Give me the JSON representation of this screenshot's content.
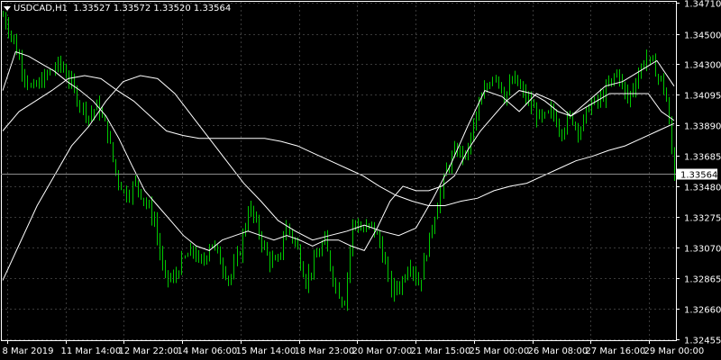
{
  "header": {
    "symbol": "USDCAD,H1",
    "ohlc": "1.33527 1.33572 1.33520 1.33564"
  },
  "colors": {
    "background": "#000000",
    "grid": "#3a3a3a",
    "axis": "#ffffff",
    "candles": "#00c800",
    "ma": "#ffffff",
    "price_line": "#8c8c8c",
    "price_label_bg": "#ffffff",
    "price_label_text": "#000000"
  },
  "chart_data": {
    "type": "line",
    "title": "USDCAD,H1",
    "ylim": [
      1.3245,
      1.3472
    ],
    "y_ticks": [
      1.3471,
      1.345,
      1.343,
      1.34095,
      1.3389,
      1.33685,
      1.3348,
      1.33275,
      1.3307,
      1.32865,
      1.3266,
      1.32455
    ],
    "y_tick_labels": [
      "1.34710",
      "1.34500",
      "1.34300",
      "1.34095",
      "1.33890",
      "1.33685",
      "1.33480",
      "1.33275",
      "1.33070",
      "1.32865",
      "1.32660",
      "1.32455"
    ],
    "x_tick_labels": [
      "8 Mar 2019",
      "11 Mar 14:00",
      "12 Mar 22:00",
      "14 Mar 06:00",
      "15 Mar 14:00",
      "18 Mar 23:00",
      "20 Mar 07:00",
      "21 Mar 15:00",
      "25 Mar 00:00",
      "26 Mar 08:00",
      "27 Mar 16:00",
      "29 Mar 00:00"
    ],
    "current_price": 1.33564,
    "current_price_label": "1.33564",
    "grid": true,
    "series": [
      {
        "values": [
          1.3462,
          1.3448,
          1.3428,
          1.3412,
          1.3418,
          1.3425,
          1.343,
          1.342,
          1.3405,
          1.3395,
          1.3402,
          1.3385,
          1.3355,
          1.3342,
          1.335,
          1.3338,
          1.3325,
          1.3288,
          1.3285,
          1.3298,
          1.3305,
          1.3295,
          1.3312,
          1.3298,
          1.3285,
          1.3305,
          1.3335,
          1.3318,
          1.33,
          1.3295,
          1.3322,
          1.3308,
          1.3285,
          1.3298,
          1.3312,
          1.3285,
          1.3268,
          1.3325,
          1.3318,
          1.3322,
          1.3308,
          1.3278,
          1.3282,
          1.3298,
          1.3282,
          1.331,
          1.3338,
          1.3362,
          1.3372,
          1.3368,
          1.3395,
          1.3412,
          1.3425,
          1.3408,
          1.342,
          1.341,
          1.34,
          1.3392,
          1.3398,
          1.3385,
          1.3395,
          1.3385,
          1.3402,
          1.3405,
          1.3415,
          1.3425,
          1.3405,
          1.342,
          1.3435,
          1.3425,
          1.3412,
          1.3356
        ]
      },
      {
        "values": [
          1.3412,
          1.3438,
          1.3435,
          1.343,
          1.3425,
          1.3418,
          1.3412,
          1.3405,
          1.3395,
          1.338,
          1.3362,
          1.3345,
          1.3335,
          1.3325,
          1.3315,
          1.3308,
          1.3305,
          1.3312,
          1.3315,
          1.3318,
          1.3315,
          1.3312,
          1.3315,
          1.3312,
          1.3308,
          1.3312,
          1.3312,
          1.3308,
          1.3305,
          1.332,
          1.3338,
          1.3348,
          1.3345,
          1.3345,
          1.3348,
          1.3355,
          1.3372,
          1.3385,
          1.3395,
          1.3405,
          1.3412,
          1.341,
          1.3405,
          1.3398,
          1.3395,
          1.34,
          1.3405,
          1.341,
          1.341,
          1.341,
          1.341,
          1.3398,
          1.3392
        ]
      },
      {
        "values": [
          1.3385,
          1.3398,
          1.3405,
          1.3412,
          1.342,
          1.3422,
          1.342,
          1.3412,
          1.3405,
          1.3395,
          1.3385,
          1.3382,
          1.338,
          1.338,
          1.338,
          1.338,
          1.338,
          1.3378,
          1.3375,
          1.337,
          1.3365,
          1.336,
          1.3355,
          1.3348,
          1.3342,
          1.3338,
          1.3335,
          1.3335,
          1.3338,
          1.334,
          1.3345,
          1.3348,
          1.335,
          1.3355,
          1.336,
          1.3365,
          1.3368,
          1.3372,
          1.3375,
          1.338,
          1.3385,
          1.339
        ]
      },
      {
        "values": [
          1.3285,
          1.331,
          1.3335,
          1.3355,
          1.3375,
          1.3388,
          1.3405,
          1.3418,
          1.3422,
          1.342,
          1.341,
          1.3395,
          1.338,
          1.3365,
          1.335,
          1.3338,
          1.3325,
          1.3318,
          1.3312,
          1.3315,
          1.3318,
          1.3322,
          1.3318,
          1.3315,
          1.332,
          1.334,
          1.3362,
          1.3388,
          1.3412,
          1.3408,
          1.3398,
          1.341,
          1.3405,
          1.3395,
          1.3405,
          1.3415,
          1.3418,
          1.3425,
          1.3432,
          1.3415
        ]
      }
    ]
  }
}
